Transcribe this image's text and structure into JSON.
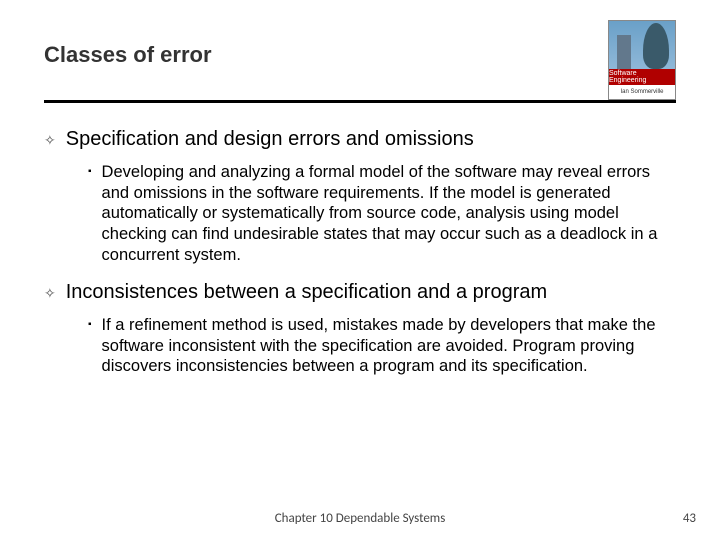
{
  "title": "Classes of error",
  "logo": {
    "brand": "Software Engineering",
    "sub": "Ian Sommerville"
  },
  "sections": [
    {
      "heading": "Specification and design errors and omissions",
      "body": "Developing and analyzing a formal model of the software may reveal errors and omissions in the software requirements. If the model is generated automatically or systematically from source code, analysis using model checking can find undesirable states that may occur such as a deadlock in a concurrent system."
    },
    {
      "heading": "Inconsistences between a specification and a program",
      "body": "If a refinement method is used, mistakes made by developers that make the software inconsistent with the specification are avoided. Program proving discovers inconsistencies between a program and its specification."
    }
  ],
  "footer": "Chapter 10 Dependable Systems",
  "page": "43"
}
